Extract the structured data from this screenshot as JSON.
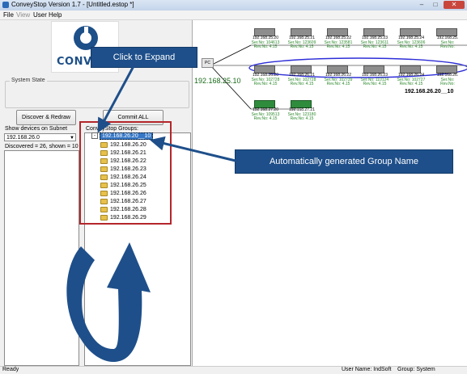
{
  "window": {
    "title": "ConveyStop Version 1.7 - [Untitled.estop *]"
  },
  "menu": [
    {
      "label": "File",
      "enabled": true
    },
    {
      "label": "View",
      "enabled": false
    },
    {
      "label": "User",
      "enabled": true
    },
    {
      "label": "Help",
      "enabled": true
    }
  ],
  "left": {
    "logo_text": "CONV",
    "system_state_label": "System State",
    "discover_button": "Discover & Redraw",
    "commit_button": "Commit ALL",
    "show_devices_label": "Show devices on Subnet",
    "subnet_value": "192.168.26.0",
    "discovered_text": "Discovered = 26, shown = 10",
    "groups_label": "ConveyStop Groups:",
    "group_root": "192.168.26.20__10",
    "group_items": [
      "192.168.26.20",
      "192.168.26.21",
      "192.168.26.22",
      "192.168.26.23",
      "192.168.26.24",
      "192.168.26.25",
      "192.168.26.26",
      "192.168.26.27",
      "192.168.26.28",
      "192.168.26.29"
    ]
  },
  "network": {
    "pc_label": "PC",
    "pc_ip": "192.168.25.10",
    "group_name": "192.168.26.20__10",
    "row1": [
      {
        "ip": "192.168.25.20",
        "ser": "Ser.No: 104613",
        "rev": "Rev.No: 4.15"
      },
      {
        "ip": "192.168.25.21",
        "ser": "Ser.No: 123609",
        "rev": "Rev.No: 4.15"
      },
      {
        "ip": "192.168.25.22",
        "ser": "Ser.No: 123581",
        "rev": "Rev.No: 4.15"
      },
      {
        "ip": "192.168.25.23",
        "ser": "Ser.No: 123611",
        "rev": "Rev.No: 4.15"
      },
      {
        "ip": "192.168.25.24",
        "ser": "Ser.No: 123606",
        "rev": "Rev.No: 4.15"
      },
      {
        "ip": "192.168.25.",
        "ser": "Ser.No:",
        "rev": "Rev.No:"
      }
    ],
    "row2": [
      {
        "ip": "192.168.26.20",
        "ser": "Ser.No: 102728",
        "rev": "Rev.No: 4.15"
      },
      {
        "ip": "192.168.26.21",
        "ser": "Ser.No: 102728",
        "rev": "Rev.No: 4.15"
      },
      {
        "ip": "192.168.26.22",
        "ser": "Ser.No: 102739",
        "rev": "Rev.No: 4.15"
      },
      {
        "ip": "192.168.26.23",
        "ser": "Ser.No: 110124",
        "rev": "Rev.No: 4.15"
      },
      {
        "ip": "192.168.26.24",
        "ser": "Ser.No: 102727",
        "rev": "Rev.No: 4.15"
      },
      {
        "ip": "192.168.26.",
        "ser": "Ser.No:",
        "rev": "Rev.No:"
      }
    ],
    "row3": [
      {
        "ip": "192.168.27.20",
        "ser": "Ser.No: 109513",
        "rev": "Rev.No: 4.15"
      },
      {
        "ip": "192.168.27.21",
        "ser": "Ser.No: 123180",
        "rev": "Rev.No: 4.15"
      }
    ]
  },
  "annotations": {
    "click_to_expand": "Click to Expand",
    "auto_group": "Automatically generated Group Name"
  },
  "status": {
    "left": "Ready",
    "user_name": "User Name: IndSoft",
    "group": "Group: System"
  },
  "colors": {
    "callout": "#1e4f8a",
    "highlight_box": "#b3262b",
    "ellipse": "#2d2dd8"
  }
}
